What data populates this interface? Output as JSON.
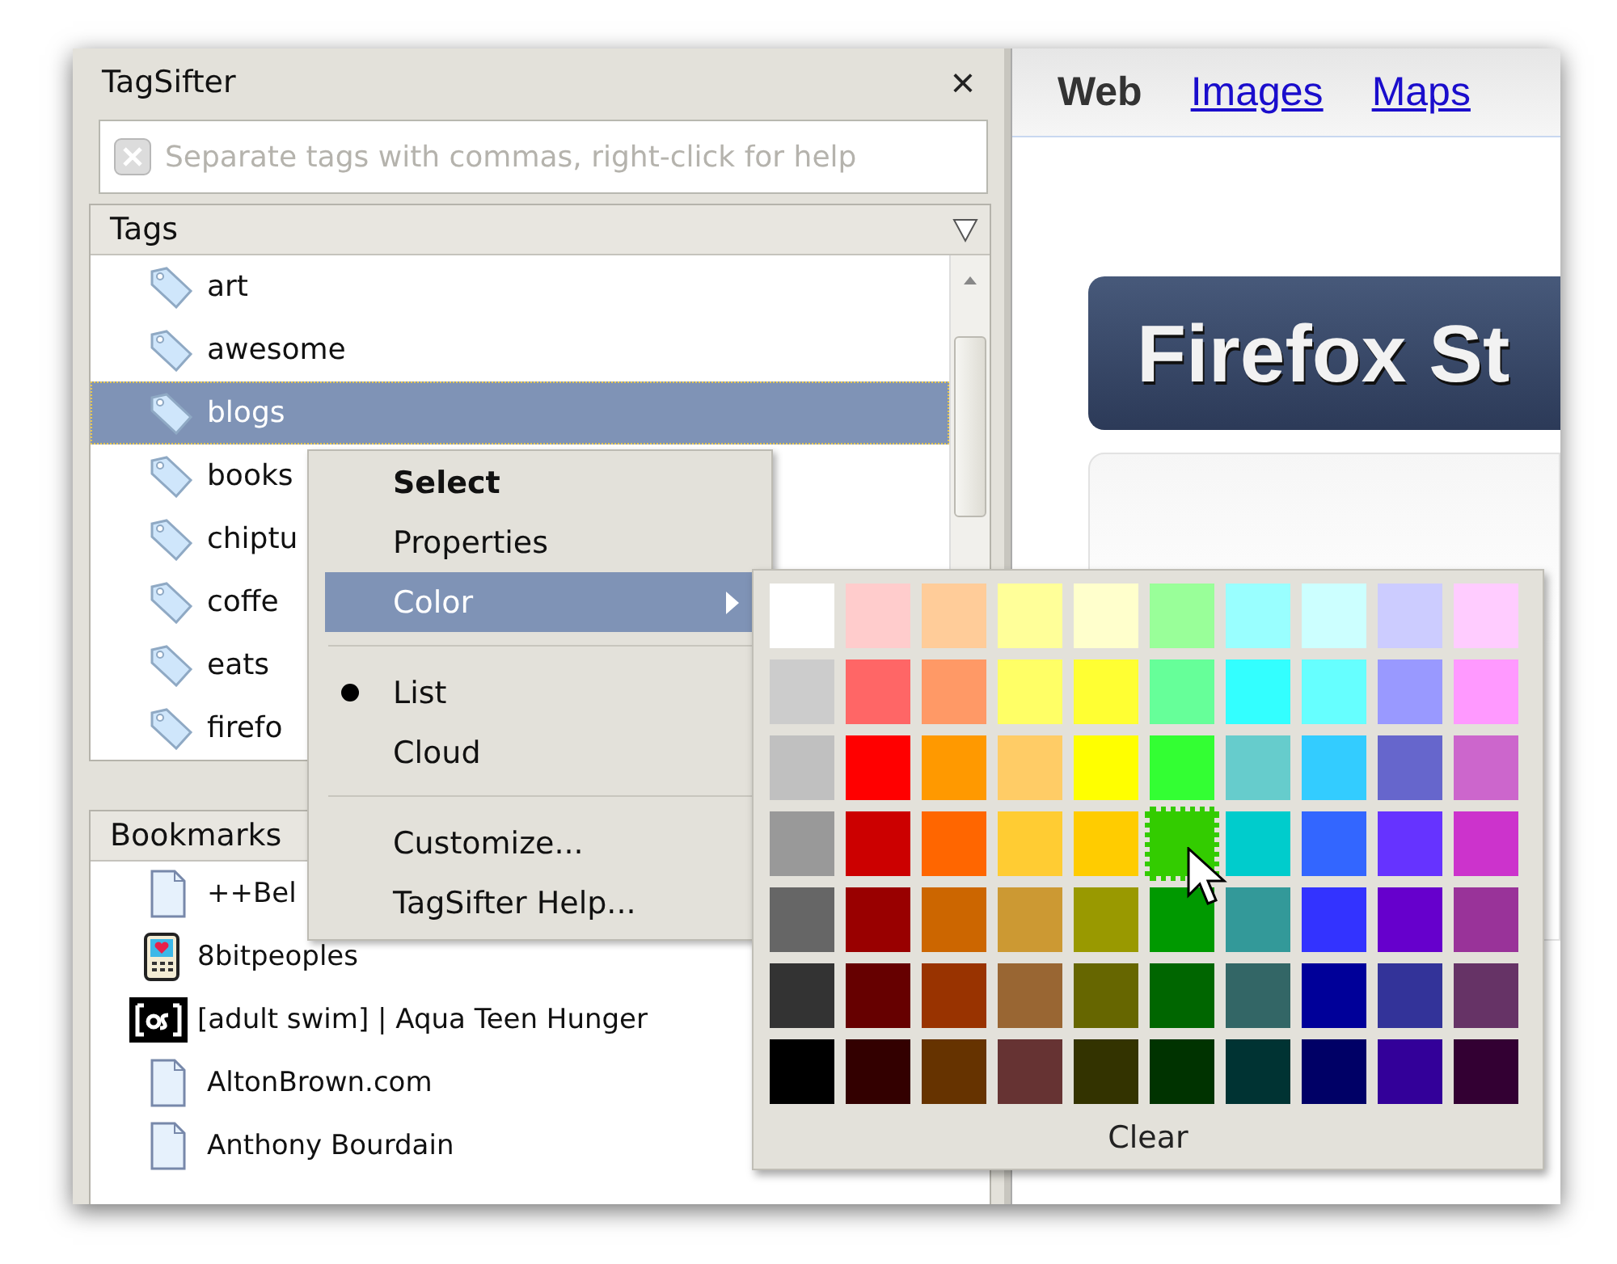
{
  "sidebar": {
    "title": "TagSifter",
    "close_label": "×",
    "search": {
      "placeholder": "Separate tags with commas, right-click for help"
    },
    "tags_panel": {
      "header": "Tags",
      "items": [
        {
          "label": "art",
          "selected": false
        },
        {
          "label": "awesome",
          "selected": false
        },
        {
          "label": "blogs",
          "selected": true
        },
        {
          "label": "books",
          "selected": false
        },
        {
          "label": "chiptu",
          "selected": false
        },
        {
          "label": "coffe",
          "selected": false
        },
        {
          "label": "eats",
          "selected": false
        },
        {
          "label": "firefo",
          "selected": false
        }
      ]
    },
    "bookmarks_panel": {
      "header": "Bookmarks",
      "items": [
        {
          "label": "++Bel",
          "kind": "page"
        },
        {
          "label": "8bitpeoples",
          "kind": "phone"
        },
        {
          "label": "[adult swim] | Aqua Teen Hunger",
          "kind": "badge"
        },
        {
          "label": "AltonBrown.com",
          "kind": "page"
        },
        {
          "label": "Anthony Bourdain",
          "kind": "page"
        }
      ]
    }
  },
  "browser": {
    "tabs": [
      {
        "label": "Web",
        "selected": true
      },
      {
        "label": "Images",
        "selected": false
      },
      {
        "label": "Maps",
        "selected": false
      }
    ],
    "banner": "Firefox St"
  },
  "context_menu": {
    "groups": [
      {
        "items": [
          {
            "label": "Select",
            "kind": "command",
            "default": true,
            "selected": false
          },
          {
            "label": "Properties",
            "kind": "command",
            "default": false,
            "selected": false
          },
          {
            "label": "Color",
            "kind": "submenu",
            "default": false,
            "selected": true
          }
        ]
      },
      {
        "items": [
          {
            "label": "List",
            "kind": "radio",
            "checked": true,
            "default": false,
            "selected": false
          },
          {
            "label": "Cloud",
            "kind": "radio",
            "checked": false,
            "default": false,
            "selected": false
          }
        ]
      },
      {
        "items": [
          {
            "label": "Customize...",
            "kind": "command",
            "default": false,
            "selected": false
          },
          {
            "label": "TagSifter Help...",
            "kind": "command",
            "default": false,
            "selected": false
          }
        ]
      }
    ]
  },
  "color_palette": {
    "swatches": [
      {
        "color": "#ffffff",
        "selected": false
      },
      {
        "color": "#ffcccc",
        "selected": false
      },
      {
        "color": "#ffcc99",
        "selected": false
      },
      {
        "color": "#ffff99",
        "selected": false
      },
      {
        "color": "#ffffcc",
        "selected": false
      },
      {
        "color": "#99ff99",
        "selected": false
      },
      {
        "color": "#99ffff",
        "selected": false
      },
      {
        "color": "#ccffff",
        "selected": false
      },
      {
        "color": "#ccccff",
        "selected": false
      },
      {
        "color": "#ffccff",
        "selected": false
      },
      {
        "color": "#cccccc",
        "selected": false
      },
      {
        "color": "#ff6666",
        "selected": false
      },
      {
        "color": "#ff9966",
        "selected": false
      },
      {
        "color": "#ffff66",
        "selected": false
      },
      {
        "color": "#ffff33",
        "selected": false
      },
      {
        "color": "#66ff99",
        "selected": false
      },
      {
        "color": "#33ffff",
        "selected": false
      },
      {
        "color": "#66ffff",
        "selected": false
      },
      {
        "color": "#9999ff",
        "selected": false
      },
      {
        "color": "#ff99ff",
        "selected": false
      },
      {
        "color": "#c0c0c0",
        "selected": false
      },
      {
        "color": "#ff0000",
        "selected": false
      },
      {
        "color": "#ff9900",
        "selected": false
      },
      {
        "color": "#ffcc66",
        "selected": false
      },
      {
        "color": "#ffff00",
        "selected": false
      },
      {
        "color": "#33ff33",
        "selected": false
      },
      {
        "color": "#66cccc",
        "selected": false
      },
      {
        "color": "#33ccff",
        "selected": false
      },
      {
        "color": "#6666cc",
        "selected": false
      },
      {
        "color": "#cc66cc",
        "selected": false
      },
      {
        "color": "#999999",
        "selected": false
      },
      {
        "color": "#cc0000",
        "selected": false
      },
      {
        "color": "#ff6600",
        "selected": false
      },
      {
        "color": "#ffcc33",
        "selected": false
      },
      {
        "color": "#ffcc00",
        "selected": false
      },
      {
        "color": "#33cc00",
        "selected": true
      },
      {
        "color": "#00cccc",
        "selected": false
      },
      {
        "color": "#3366ff",
        "selected": false
      },
      {
        "color": "#6633ff",
        "selected": false
      },
      {
        "color": "#cc33cc",
        "selected": false
      },
      {
        "color": "#666666",
        "selected": false
      },
      {
        "color": "#990000",
        "selected": false
      },
      {
        "color": "#cc6600",
        "selected": false
      },
      {
        "color": "#cc9933",
        "selected": false
      },
      {
        "color": "#999900",
        "selected": false
      },
      {
        "color": "#009900",
        "selected": false
      },
      {
        "color": "#339999",
        "selected": false
      },
      {
        "color": "#3333ff",
        "selected": false
      },
      {
        "color": "#6600cc",
        "selected": false
      },
      {
        "color": "#993399",
        "selected": false
      },
      {
        "color": "#333333",
        "selected": false
      },
      {
        "color": "#660000",
        "selected": false
      },
      {
        "color": "#993300",
        "selected": false
      },
      {
        "color": "#996633",
        "selected": false
      },
      {
        "color": "#666600",
        "selected": false
      },
      {
        "color": "#006600",
        "selected": false
      },
      {
        "color": "#336666",
        "selected": false
      },
      {
        "color": "#000099",
        "selected": false
      },
      {
        "color": "#333399",
        "selected": false
      },
      {
        "color": "#663366",
        "selected": false
      },
      {
        "color": "#000000",
        "selected": false
      },
      {
        "color": "#330000",
        "selected": false
      },
      {
        "color": "#663300",
        "selected": false
      },
      {
        "color": "#663333",
        "selected": false
      },
      {
        "color": "#333300",
        "selected": false
      },
      {
        "color": "#003300",
        "selected": false
      },
      {
        "color": "#003333",
        "selected": false
      },
      {
        "color": "#000066",
        "selected": false
      },
      {
        "color": "#330099",
        "selected": false
      },
      {
        "color": "#330033",
        "selected": false
      }
    ],
    "clear_label": "Clear"
  }
}
